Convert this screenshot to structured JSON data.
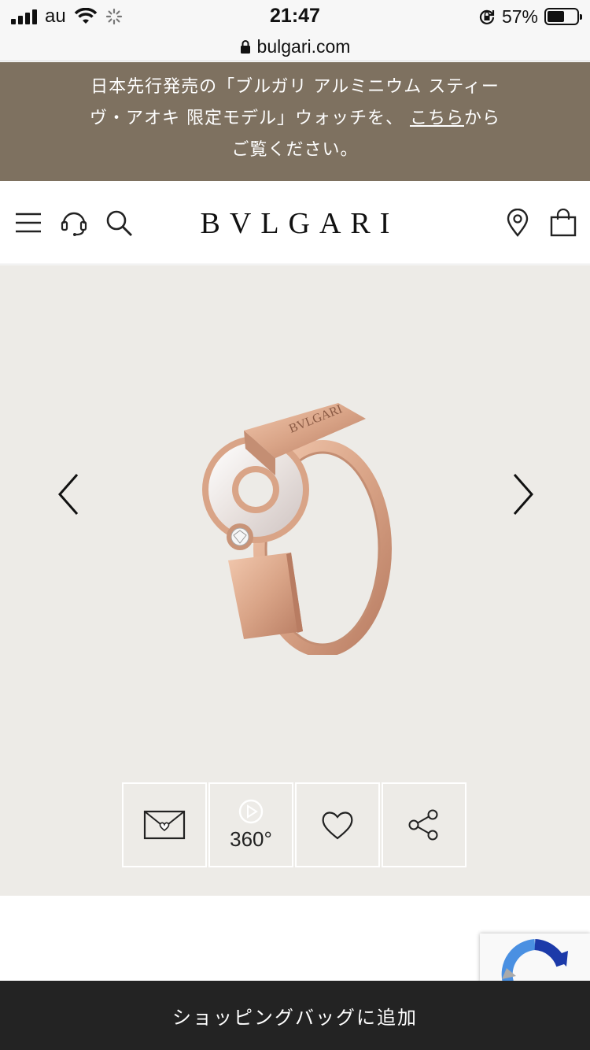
{
  "status_bar": {
    "carrier": "au",
    "time": "21:47",
    "battery_percent": "57%",
    "battery_level": 0.57
  },
  "browser": {
    "url": "bulgari.com"
  },
  "promo": {
    "line1": "日本先行発売の「ブルガリ アルミニウム スティー",
    "line2_before": "ヴ・アオキ 限定モデル」ウォッチを、",
    "link_text": "こちら",
    "line2_after": "から",
    "line3": "ご覧ください。"
  },
  "header": {
    "logo": "BVLGARI",
    "icons": [
      "menu-icon",
      "headset-icon",
      "search-icon",
      "location-pin-icon",
      "shopping-bag-icon"
    ]
  },
  "gallery": {
    "actions": [
      {
        "name": "email-heart-icon",
        "label": ""
      },
      {
        "name": "play-360-icon",
        "label": "360°"
      },
      {
        "name": "heart-icon",
        "label": ""
      },
      {
        "name": "share-icon",
        "label": ""
      }
    ]
  },
  "cart": {
    "label": "ショッピングバッグに追加"
  },
  "colors": {
    "promo_bg": "#7e7160",
    "gallery_bg": "#edebe7",
    "cart_bg": "#232323",
    "rose_gold": "#d9a487"
  }
}
